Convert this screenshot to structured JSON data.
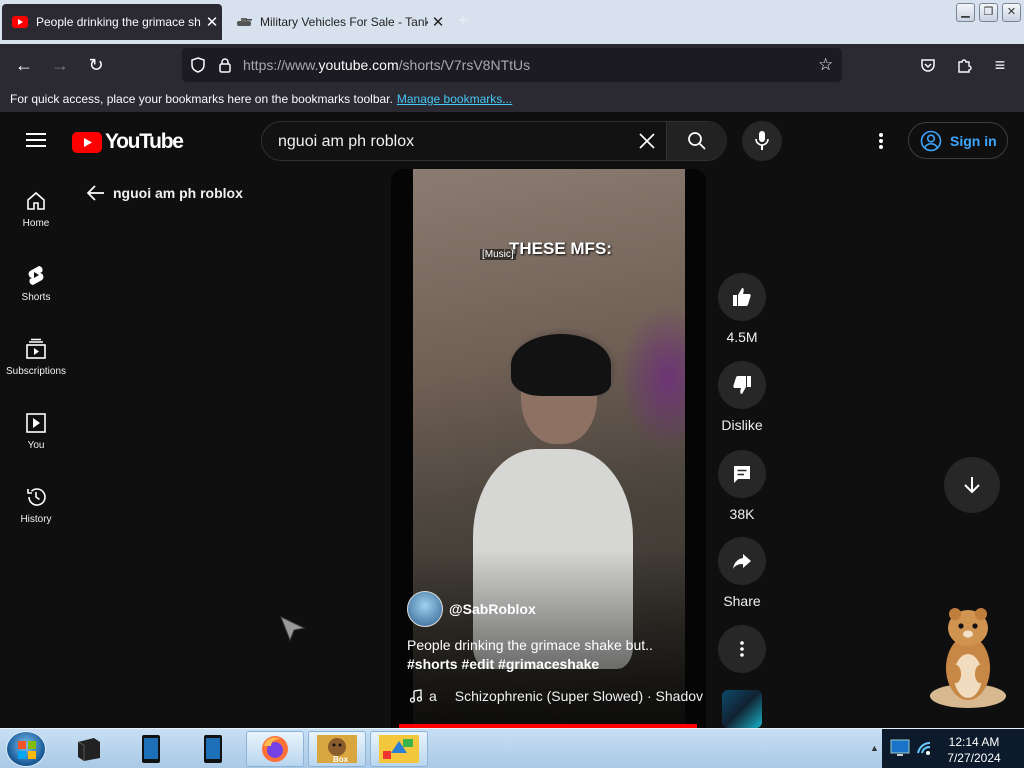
{
  "browser": {
    "tabs": [
      {
        "title": "People drinking the grimace sh",
        "favicon": "youtube-icon",
        "active": true
      },
      {
        "title": "Military Vehicles For Sale - Tank",
        "favicon": "tank-icon",
        "active": false
      }
    ],
    "url_prefix": "https://www.",
    "url_domain": "youtube.com",
    "url_path": "/shorts/V7rsV8NTtUs",
    "bookmarks_message": "For quick access, place your bookmarks here on the bookmarks toolbar.",
    "bookmarks_link": "Manage bookmarks..."
  },
  "youtube": {
    "logo_text": "YouTube",
    "search_value": "nguoi am ph roblox",
    "sign_in": "Sign in",
    "sidebar": [
      {
        "label": "Home",
        "icon": "home-icon"
      },
      {
        "label": "Shorts",
        "icon": "shorts-icon"
      },
      {
        "label": "Subscriptions",
        "icon": "subscriptions-icon"
      },
      {
        "label": "You",
        "icon": "you-icon"
      },
      {
        "label": "History",
        "icon": "history-icon"
      }
    ],
    "back_query": "nguoi am ph roblox",
    "short": {
      "overlay_caption": "THESE MFS:",
      "subtitle": "[Music]",
      "channel": "@SabRoblox",
      "title": "People drinking the grimace shake but..",
      "hashtags": "#shorts #edit #grimaceshake",
      "music_prefix": "a",
      "music": "Schizophrenic (Super Slowed) · Shadov"
    },
    "actions": {
      "likes": "4.5M",
      "dislike": "Dislike",
      "comments": "38K",
      "share": "Share"
    }
  },
  "taskbar": {
    "time": "12:14 AM",
    "date": "7/27/2024",
    "box_label": "Box"
  },
  "colors": {
    "youtube_red": "#ff0000",
    "link_blue": "#3ea6ff",
    "firefox_chrome": "#2b2a33"
  }
}
